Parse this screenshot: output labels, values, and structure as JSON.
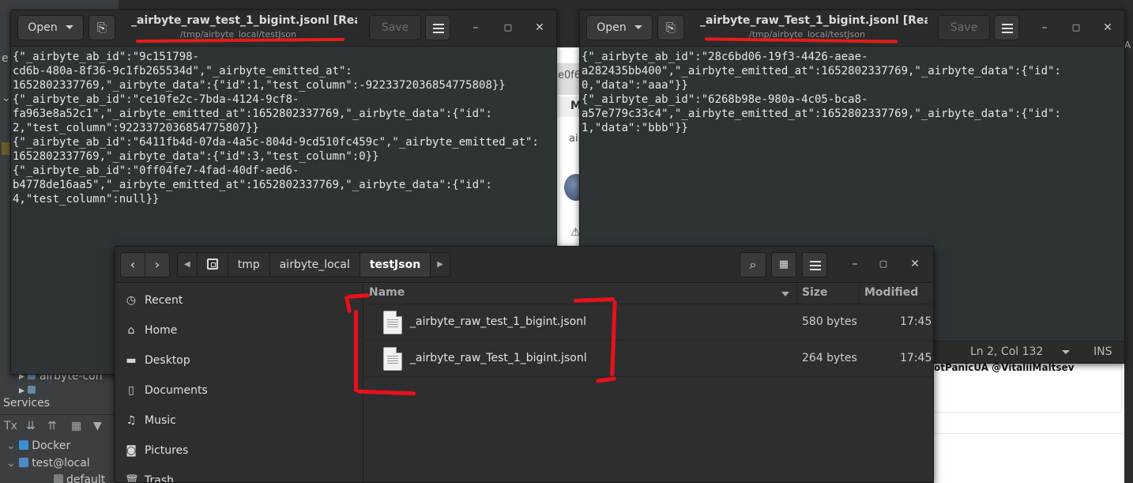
{
  "ide": {
    "services_label": "Services",
    "tree_items": [
      "airbyte-con",
      "airbyte"
    ],
    "docker": "Docker",
    "test_local": "test@local",
    "default": "default"
  },
  "browser": {
    "tab_fragment": "e0f6",
    "m_letter": "M",
    "ai_fragment": "ai",
    "tweet": "otPanicUA @VitaliiMaltsev",
    "link_fragment": "n"
  },
  "editor_left": {
    "open_label": "Open",
    "save_label": "Save",
    "title": "_airbyte_raw_test_1_bigint.jsonl [Rea...",
    "subtitle": "/tmp/airbyte_local/testJson",
    "content": "{\"_airbyte_ab_id\":\"9c151798-\ncd6b-480a-8f36-9c1fb265534d\",\"_airbyte_emitted_at\":\n1652802337769,\"_airbyte_data\":{\"id\":1,\"test_column\":-9223372036854775808}}\n{\"_airbyte_ab_id\":\"ce10fe2c-7bda-4124-9cf8-\nfa963e8a52c1\",\"_airbyte_emitted_at\":1652802337769,\"_airbyte_data\":{\"id\":\n2,\"test_column\":9223372036854775807}}\n{\"_airbyte_ab_id\":\"6411fb4d-07da-4a5c-804d-9cd510fc459c\",\"_airbyte_emitted_at\":\n1652802337769,\"_airbyte_data\":{\"id\":3,\"test_column\":0}}\n{\"_airbyte_ab_id\":\"0ff04fe7-4fad-40df-aed6-\nb4778de16aa5\",\"_airbyte_emitted_at\":1652802337769,\"_airbyte_data\":{\"id\":\n4,\"test_column\":null}}"
  },
  "editor_right": {
    "open_label": "Open",
    "save_label": "Save",
    "title": "_airbyte_raw_Test_1_bigint.jsonl [Rea...",
    "subtitle": "/tmp/airbyte_local/testJson",
    "content": "{\"_airbyte_ab_id\":\"28c6bd06-19f3-4426-aeae-\na282435bb400\",\"_airbyte_emitted_at\":1652802337769,\"_airbyte_data\":{\"id\":\n0,\"data\":\"aaa\"}}\n{\"_airbyte_ab_id\":\"6268b98e-980a-4c05-bca8-\na57e779c33c4\",\"_airbyte_emitted_at\":1652802337769,\"_airbyte_data\":{\"id\":\n1,\"data\":\"bbb\"}}",
    "status_position": "Ln 2, Col 132",
    "status_mode": "INS"
  },
  "file_manager": {
    "breadcrumbs": [
      "tmp",
      "airbyte_local",
      "testJson"
    ],
    "columns": {
      "name": "Name",
      "size": "Size",
      "modified": "Modified"
    },
    "sidebar": [
      {
        "icon": "clock-icon",
        "label": "Recent"
      },
      {
        "icon": "home-icon",
        "label": "Home"
      },
      {
        "icon": "folder-icon",
        "label": "Desktop"
      },
      {
        "icon": "document-icon",
        "label": "Documents"
      },
      {
        "icon": "music-icon",
        "label": "Music"
      },
      {
        "icon": "camera-icon",
        "label": "Pictures"
      },
      {
        "icon": "trash-icon",
        "label": "Trash"
      }
    ],
    "files": [
      {
        "name": "_airbyte_raw_test_1_bigint.jsonl",
        "size": "580 bytes",
        "modified": "17:45"
      },
      {
        "name": "_airbyte_raw_Test_1_bigint.jsonl",
        "size": "264 bytes",
        "modified": "17:45"
      }
    ]
  },
  "colors": {
    "annotation_red": "#e8101c",
    "window_dark": "#2b2b2b"
  }
}
